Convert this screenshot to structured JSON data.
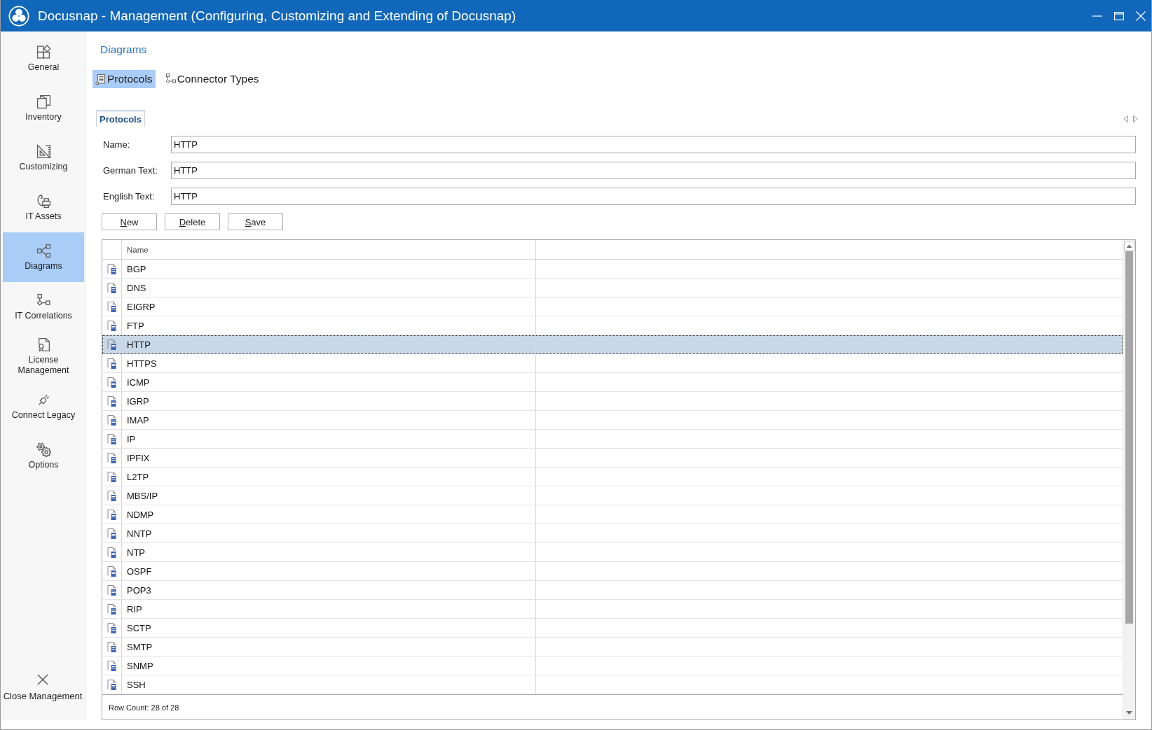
{
  "window": {
    "title": "Docusnap - Management (Configuring, Customizing and Extending of Docusnap)"
  },
  "sidebar": {
    "items": [
      {
        "label": "General",
        "selected": false
      },
      {
        "label": "Inventory",
        "selected": false
      },
      {
        "label": "Customizing",
        "selected": false
      },
      {
        "label": "IT Assets",
        "selected": false
      },
      {
        "label": "Diagrams",
        "selected": true
      },
      {
        "label": "IT Correlations",
        "selected": false
      },
      {
        "label": "License Management",
        "selected": false
      },
      {
        "label": "Connect Legacy",
        "selected": false
      },
      {
        "label": "Options",
        "selected": false
      }
    ],
    "close_button": {
      "label": "Close Management"
    }
  },
  "page": {
    "title": "Diagrams",
    "toolbar": [
      {
        "label": "Protocols",
        "selected": true
      },
      {
        "label": "Connector Types",
        "selected": false
      }
    ],
    "tabs": [
      {
        "label": "Protocols",
        "selected": true
      }
    ],
    "form": {
      "fields": [
        {
          "label": "Name:",
          "value": "HTTP"
        },
        {
          "label": "German Text:",
          "value": "HTTP"
        },
        {
          "label": "English Text:",
          "value": "HTTP"
        }
      ],
      "buttons": [
        "New",
        "Delete",
        "Save"
      ]
    },
    "table": {
      "columns": [
        "Name"
      ],
      "rows": [
        {
          "name": "BGP",
          "selected": false
        },
        {
          "name": "DNS",
          "selected": false
        },
        {
          "name": "EIGRP",
          "selected": false
        },
        {
          "name": "FTP",
          "selected": false
        },
        {
          "name": "HTTP",
          "selected": true
        },
        {
          "name": "HTTPS",
          "selected": false
        },
        {
          "name": "ICMP",
          "selected": false
        },
        {
          "name": "IGRP",
          "selected": false
        },
        {
          "name": "IMAP",
          "selected": false
        },
        {
          "name": "IP",
          "selected": false
        },
        {
          "name": "IPFIX",
          "selected": false
        },
        {
          "name": "L2TP",
          "selected": false
        },
        {
          "name": "MBS/IP",
          "selected": false
        },
        {
          "name": "NDMP",
          "selected": false
        },
        {
          "name": "NNTP",
          "selected": false
        },
        {
          "name": "NTP",
          "selected": false
        },
        {
          "name": "OSPF",
          "selected": false
        },
        {
          "name": "POP3",
          "selected": false
        },
        {
          "name": "RIP",
          "selected": false
        },
        {
          "name": "SCTP",
          "selected": false
        },
        {
          "name": "SMTP",
          "selected": false
        },
        {
          "name": "SNMP",
          "selected": false
        },
        {
          "name": "SSH",
          "selected": false
        }
      ],
      "status": "Row Count: 28 of 28"
    }
  }
}
